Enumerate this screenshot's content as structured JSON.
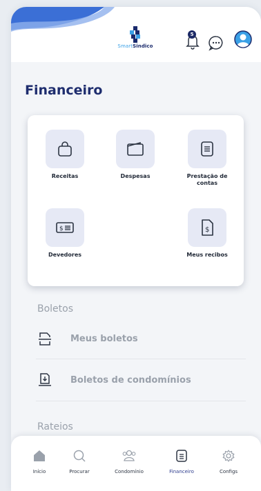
{
  "header": {
    "logo_word_a": "Smart",
    "logo_word_b": "Sindico",
    "notification_count": "5"
  },
  "page_title": "Financeiro",
  "tiles": [
    {
      "label": "Receitas",
      "icon": "shopping-bag-icon"
    },
    {
      "label": "Despesas",
      "icon": "wallet-icon"
    },
    {
      "label": "Prestação de contas",
      "icon": "document-list-icon"
    },
    {
      "label": "Devedores",
      "icon": "bill-icon"
    },
    {
      "label": "Meus recibos",
      "icon": "receipt-icon"
    }
  ],
  "boletos": {
    "section": "Boletos",
    "items": [
      {
        "label": "Meus boletos",
        "icon": "printer-icon"
      },
      {
        "label": "Boletos de condomínios",
        "icon": "download-doc-icon"
      }
    ]
  },
  "rateios": {
    "section": "Rateios"
  },
  "nav": [
    {
      "label": "Início",
      "icon": "home-icon"
    },
    {
      "label": "Procurar",
      "icon": "search-icon"
    },
    {
      "label": "Condomínio",
      "icon": "people-icon"
    },
    {
      "label": "Financeiro",
      "icon": "document-icon",
      "active": true
    },
    {
      "label": "Configs",
      "icon": "gear-icon"
    }
  ],
  "colors": {
    "brand_navy": "#1e2d6e",
    "accent_blue": "#3aa0e6",
    "tile_bg": "#e6e9f5",
    "muted_text": "#9aa1ab"
  }
}
